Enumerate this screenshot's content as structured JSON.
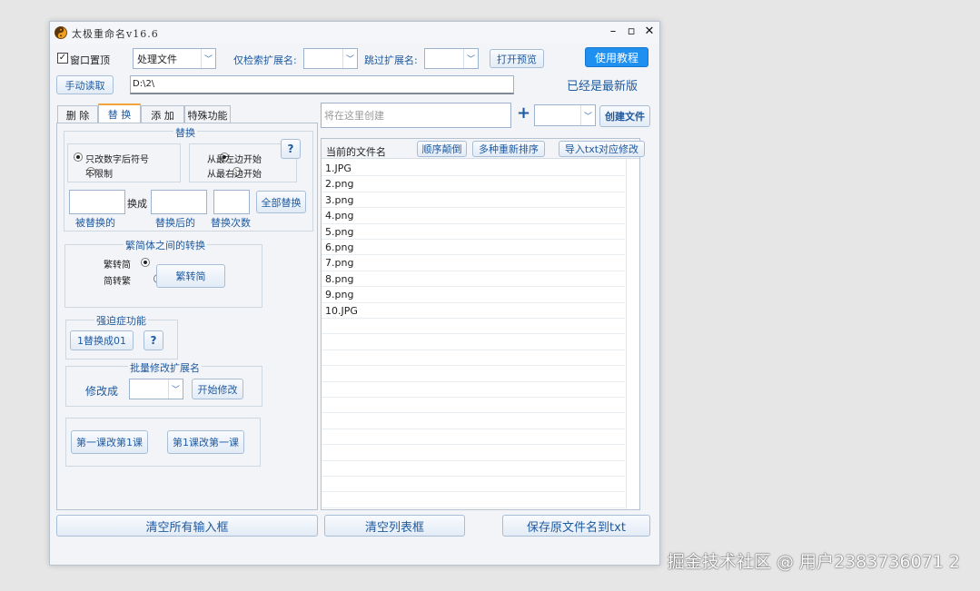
{
  "window": {
    "title": "太极重命名v16.6"
  },
  "toolbar": {
    "always_on_top": "窗口置顶",
    "mode_value": "处理文件",
    "only_ext_label": "仅检索扩展名:",
    "skip_ext_label": "跳过扩展名:",
    "open_preview": "打开预览",
    "tutorial": "使用教程",
    "manual_read": "手动读取",
    "path_value": "D:\\2\\",
    "version_status": "已经是最新版"
  },
  "tabs": [
    "删 除",
    "替 换",
    "添 加",
    "特殊功能"
  ],
  "replace_panel": {
    "group_title": "替换",
    "help": "?",
    "opt_digits_only": "只改数字后符号",
    "opt_no_limit": "不限制",
    "opt_from_left": "从最左边开始",
    "opt_from_right": "从最右边开始",
    "change_to": "换成",
    "replace_all": "全部替换",
    "lbl_replaced": "被替换的",
    "lbl_after": "替换后的",
    "lbl_times": "替换次数"
  },
  "conversion": {
    "title": "繁简体之间的转换",
    "opt_trad_to_simp": "繁转简",
    "opt_simp_to_trad": "简转繁",
    "button": "繁转简"
  },
  "ocd": {
    "title": "强迫症功能",
    "button": "1替换成01",
    "help": "?"
  },
  "batch_ext": {
    "title": "批量修改扩展名",
    "label": "修改成",
    "button": "开始修改"
  },
  "lesson": {
    "btn1": "第一课改第1课",
    "btn2": "第1课改第一课"
  },
  "right_panel": {
    "create_placeholder": "将在这里创建",
    "plus": "+",
    "create_button": "创建文件",
    "col_current": "当前的文件名",
    "btn_reverse": "顺序颠倒",
    "btn_resort": "多种重新排序",
    "btn_import": "导入txt对应修改",
    "files": [
      "1.JPG",
      "2.png",
      "3.png",
      "4.png",
      "5.png",
      "6.png",
      "7.png",
      "8.png",
      "9.png",
      "10.JPG"
    ]
  },
  "bottom": {
    "clear_inputs": "清空所有输入框",
    "clear_list": "清空列表框",
    "save_txt": "保存原文件名到txt"
  },
  "watermark": "掘金技术社区 @ 用户2383736071 2"
}
